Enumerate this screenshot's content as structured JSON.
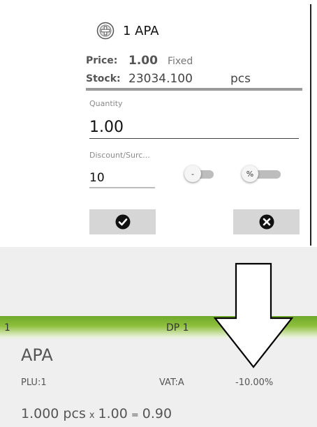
{
  "dialog": {
    "title": "1 APA",
    "price_label": "Price:",
    "price_value": "1.00",
    "price_mode": "Fixed",
    "stock_label": "Stock:",
    "stock_value": "23034.100",
    "stock_unit": "pcs",
    "quantity_caption": "Quantity",
    "quantity_value": "1.00",
    "discount_caption": "Discount/Surc...",
    "discount_value": "10",
    "sign_toggle_label": "-",
    "percent_toggle_label": "%",
    "icons": {
      "title": "plus-circle-icon",
      "confirm": "checkmark-icon",
      "cancel": "close-icon"
    }
  },
  "receipt_line": {
    "line_number": "1",
    "department": "DP 1",
    "item_name": "APA",
    "plu": "PLU:1",
    "vat": "VAT:A",
    "discount": "-10.00%",
    "quantity_text": "1.000 pcs",
    "times": "x",
    "unit_price": "1.00",
    "equals": "=",
    "total": "0.90"
  },
  "colors": {
    "accent_green": "#6ea82a",
    "button_gray": "#d6d6d6",
    "receipt_bg": "#efefef"
  },
  "annotation": {
    "shape": "down-arrow-outline"
  }
}
